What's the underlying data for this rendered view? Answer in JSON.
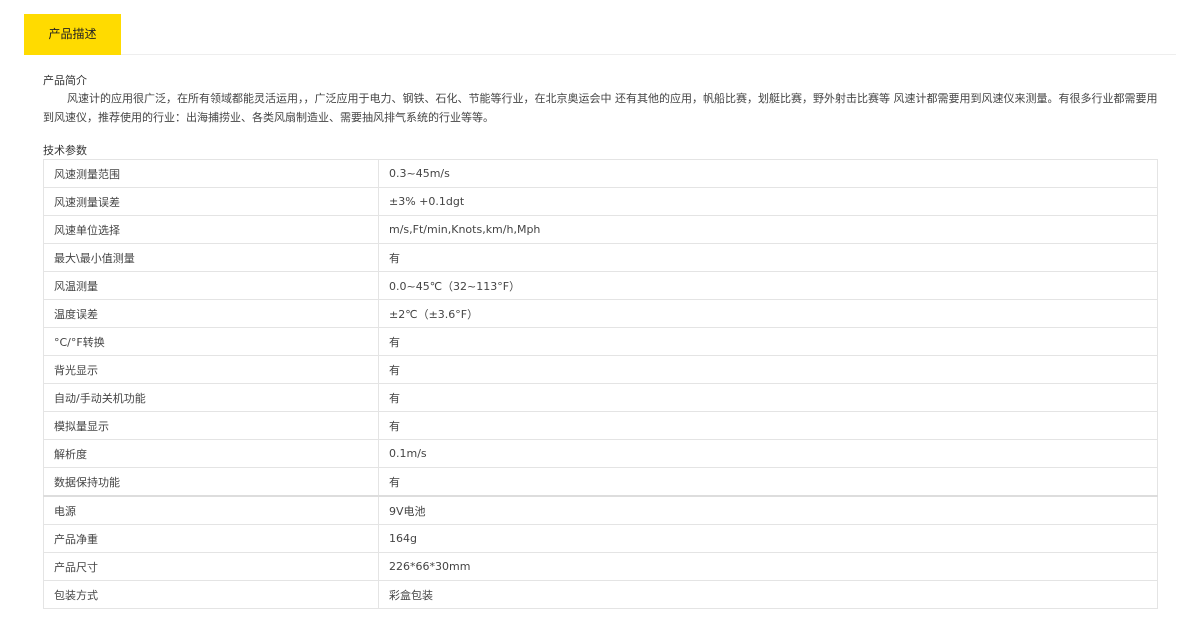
{
  "tabs": {
    "active_label": "产品描述"
  },
  "intro": {
    "heading": "产品简介",
    "text": "风速计的应用很广泛，在所有领域都能灵活运用，，广泛应用于电力、钢铁、石化、节能等行业，在北京奥运会中 还有其他的应用，帆船比赛，划艇比赛，野外射击比赛等 风速计都需要用到风速仪来测量。有很多行业都需要用到风速仪，推荐使用的行业：出海捕捞业、各类风扇制造业、需要抽风排气系统的行业等等。"
  },
  "specs": {
    "heading": "技术参数",
    "rows": [
      {
        "name": "风速测量范围",
        "value": "0.3~45m/s"
      },
      {
        "name": "风速测量误差",
        "value": "±3% +0.1dgt"
      },
      {
        "name": "风速单位选择",
        "value": "m/s,Ft/min,Knots,km/h,Mph"
      },
      {
        "name": "最大\\最小值测量",
        "value": "有"
      },
      {
        "name": "风温测量",
        "value": "0.0~45℃（32~113°F）"
      },
      {
        "name": "温度误差",
        "value": "±2℃（±3.6°F）"
      },
      {
        "name": "°C/°F转换",
        "value": "有"
      },
      {
        "name": "背光显示",
        "value": "有"
      },
      {
        "name": "自动/手动关机功能",
        "value": "有"
      },
      {
        "name": "模拟量显示",
        "value": "有"
      },
      {
        "name": "解析度",
        "value": "0.1m/s"
      },
      {
        "name": "数据保持功能",
        "value": "有"
      },
      {
        "name": "电源",
        "value": "9V电池"
      },
      {
        "name": "产品净重",
        "value": "164g"
      },
      {
        "name": "产品尺寸",
        "value": "226*66*30mm"
      },
      {
        "name": "包装方式",
        "value": "彩盒包装"
      }
    ]
  },
  "colors": {
    "tab_accent": "#ffdb00",
    "border": "#e4e4e4",
    "text": "#444444"
  }
}
